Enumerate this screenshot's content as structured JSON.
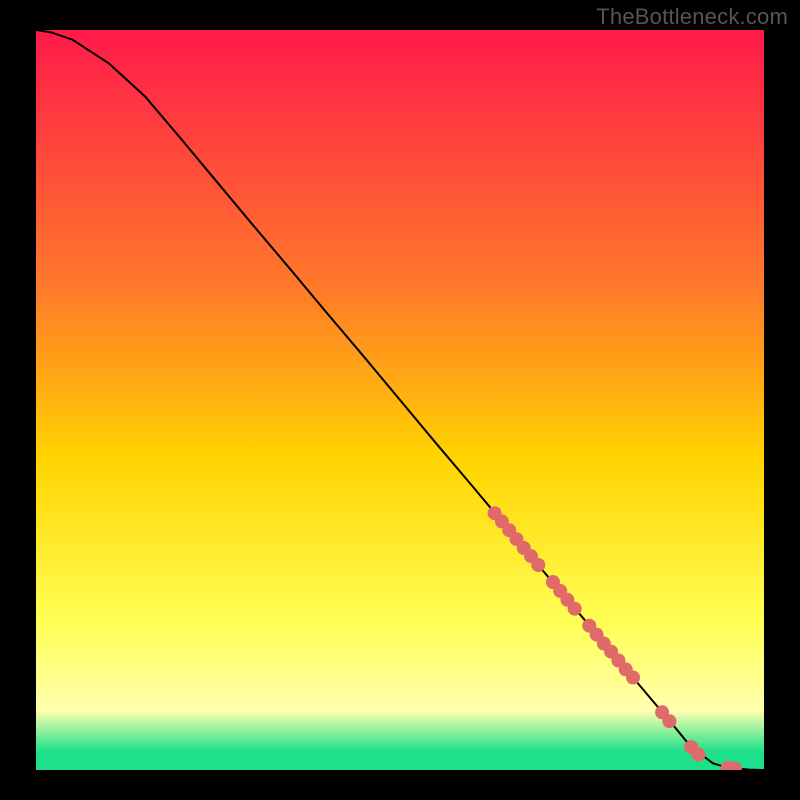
{
  "watermark": "TheBottleneck.com",
  "colors": {
    "gradient_top": "#ff1a4a",
    "gradient_mid1": "#ff7a2a",
    "gradient_mid2": "#ffd400",
    "gradient_mid3": "#ffff55",
    "gradient_low": "#ffffaf",
    "gradient_green": "#1fe08a",
    "curve": "#000000",
    "marker": "#e06a6a"
  },
  "chart_data": {
    "type": "line",
    "title": "",
    "xlabel": "",
    "ylabel": "",
    "xlim": [
      0,
      100
    ],
    "ylim": [
      0,
      100
    ],
    "x": [
      0,
      2,
      5,
      10,
      15,
      20,
      25,
      30,
      35,
      40,
      45,
      50,
      55,
      60,
      65,
      70,
      75,
      80,
      82,
      85,
      88,
      90,
      93,
      95,
      98,
      100
    ],
    "values": [
      100,
      99.7,
      98.7,
      95.5,
      91.0,
      85.2,
      79.3,
      73.4,
      67.6,
      61.7,
      55.9,
      50.0,
      44.1,
      38.3,
      32.4,
      26.5,
      20.7,
      14.8,
      12.5,
      9.0,
      5.5,
      3.1,
      0.9,
      0.3,
      0.05,
      0
    ],
    "series": [
      {
        "name": "highlighted-points",
        "x": [
          63,
          64,
          65,
          66,
          67,
          68,
          69,
          71,
          72,
          73,
          74,
          76,
          77,
          78,
          79,
          80,
          81,
          82,
          86,
          87,
          90,
          91,
          95,
          96
        ],
        "y": [
          34.7,
          33.6,
          32.4,
          31.2,
          30.0,
          28.9,
          27.7,
          25.4,
          24.2,
          23.0,
          21.8,
          19.5,
          18.3,
          17.1,
          16.0,
          14.8,
          13.6,
          12.5,
          7.8,
          6.6,
          3.1,
          2.1,
          0.3,
          0.2
        ]
      }
    ]
  }
}
